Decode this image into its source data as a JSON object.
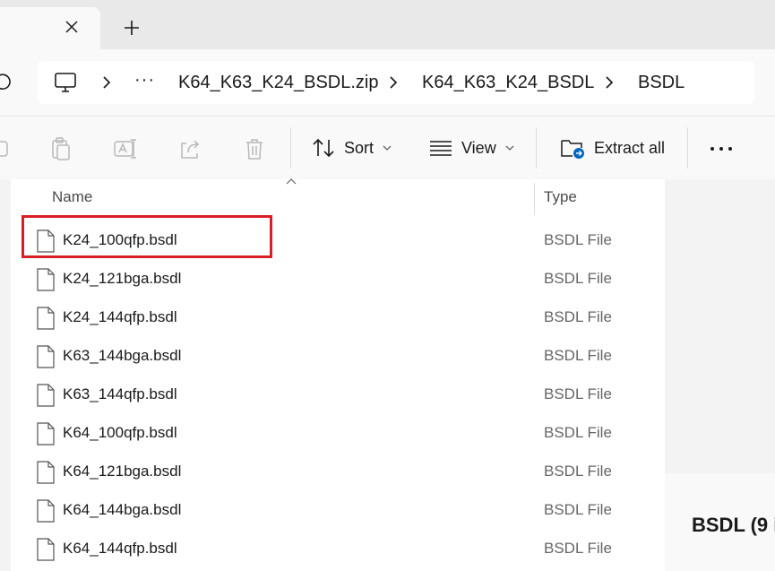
{
  "tabbar": {
    "close_icon": "close-icon",
    "new_tab_icon": "plus-icon"
  },
  "address": {
    "refresh_icon": "refresh-icon",
    "computer_icon": "computer-icon",
    "more_label": "···",
    "crumbs": [
      {
        "label": "K64_K63_K24_BSDL.zip"
      },
      {
        "label": "K64_K63_K24_BSDL"
      },
      {
        "label": "BSDL"
      }
    ]
  },
  "commandbar": {
    "icons": [
      "new-icon",
      "paste-icon",
      "rename-icon",
      "share-icon",
      "delete-icon"
    ],
    "sort_label": "Sort",
    "view_label": "View",
    "extract_label": "Extract all",
    "more_icon": "more-options-icon"
  },
  "filelist": {
    "columns": {
      "name": "Name",
      "type": "Type"
    },
    "rows": [
      {
        "name": "K24_100qfp.bsdl",
        "type": "BSDL File"
      },
      {
        "name": "K24_121bga.bsdl",
        "type": "BSDL File"
      },
      {
        "name": "K24_144qfp.bsdl",
        "type": "BSDL File"
      },
      {
        "name": "K63_144bga.bsdl",
        "type": "BSDL File"
      },
      {
        "name": "K63_144qfp.bsdl",
        "type": "BSDL File"
      },
      {
        "name": "K64_100qfp.bsdl",
        "type": "BSDL File"
      },
      {
        "name": "K64_121bga.bsdl",
        "type": "BSDL File"
      },
      {
        "name": "K64_144bga.bsdl",
        "type": "BSDL File"
      },
      {
        "name": "K64_144qfp.bsdl",
        "type": "BSDL File"
      }
    ]
  },
  "details": {
    "title": "BSDL (9 i"
  },
  "colors": {
    "highlight": "#d81f26",
    "accent": "#0067c0"
  }
}
